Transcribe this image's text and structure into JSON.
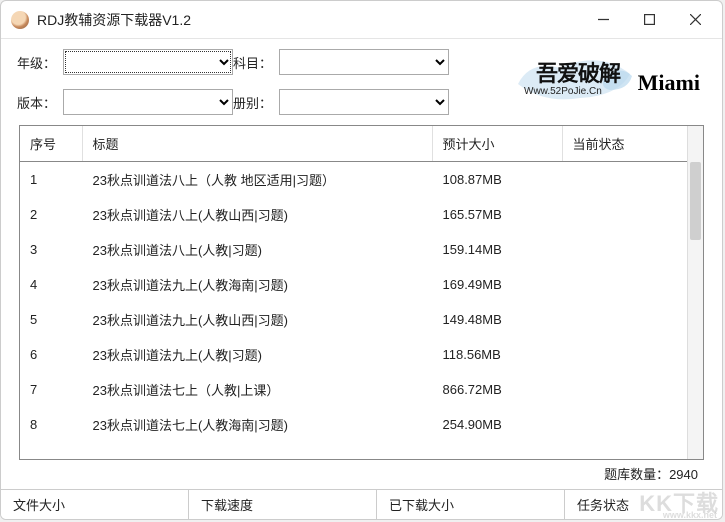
{
  "window": {
    "title": "RDJ教辅资源下载器V1.2"
  },
  "filters": {
    "grade_label": "年级：",
    "subject_label": "科目：",
    "version_label": "版本：",
    "volume_label": "册别："
  },
  "logo": {
    "text1": "吾爱破解",
    "text2": "Www.52PoJie.Cn",
    "brand": "Miami"
  },
  "table": {
    "headers": {
      "seq": "序号",
      "title": "标题",
      "size": "预计大小",
      "status": "当前状态"
    },
    "rows": [
      {
        "seq": "1",
        "title": "23秋点训道法八上（人教 地区适用|习题）",
        "size": "108.87MB",
        "status": ""
      },
      {
        "seq": "2",
        "title": "23秋点训道法八上(人教山西|习题)",
        "size": "165.57MB",
        "status": ""
      },
      {
        "seq": "3",
        "title": "23秋点训道法八上(人教|习题)",
        "size": "159.14MB",
        "status": ""
      },
      {
        "seq": "4",
        "title": "23秋点训道法九上(人教海南|习题)",
        "size": "169.49MB",
        "status": ""
      },
      {
        "seq": "5",
        "title": "23秋点训道法九上(人教山西|习题)",
        "size": "149.48MB",
        "status": ""
      },
      {
        "seq": "6",
        "title": "23秋点训道法九上(人教|习题)",
        "size": "118.56MB",
        "status": ""
      },
      {
        "seq": "7",
        "title": "23秋点训道法七上（人教|上课）",
        "size": "866.72MB",
        "status": ""
      },
      {
        "seq": "8",
        "title": "23秋点训道法七上(人教海南|习题)",
        "size": "254.90MB",
        "status": ""
      }
    ]
  },
  "count": {
    "label": "题库数量：",
    "value": "2940"
  },
  "statusbar": {
    "file_size": "文件大小",
    "download_speed": "下载速度",
    "downloaded_size": "已下载大小",
    "task_status": "任务状态"
  },
  "watermark": {
    "main": "KK下载",
    "sub": "www.kkx.net"
  }
}
